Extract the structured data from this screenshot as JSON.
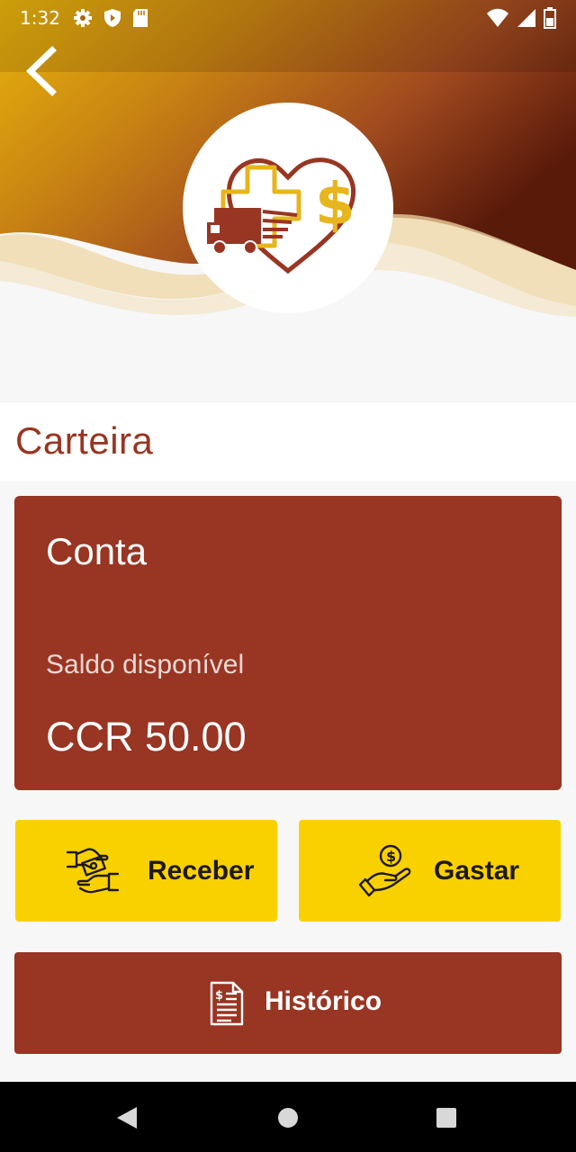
{
  "status_bar": {
    "time": "1:32",
    "left_icons": [
      "gear-icon",
      "shield-icon",
      "sd-card-icon"
    ],
    "right_icons": [
      "wifi-icon",
      "signal-icon",
      "battery-icon"
    ]
  },
  "header": {
    "back_icon": "chevron-left-icon",
    "logo": "truck-cross-heart-dollar-logo",
    "gradient_colors": [
      "#e8b10b",
      "#b5701e",
      "#8d3520",
      "#5e1d0c"
    ]
  },
  "page": {
    "title": "Carteira"
  },
  "account_card": {
    "name": "Conta",
    "balance_label": "Saldo disponível",
    "balance_value": "CCR 50.00",
    "color": "#983523"
  },
  "actions": {
    "receive_label": "Receber",
    "receive_icon": "hands-exchange-money-icon",
    "spend_label": "Gastar",
    "spend_icon": "hand-coin-icon",
    "history_label": "Histórico",
    "history_icon": "document-dollar-icon",
    "yellow": "#fad100"
  },
  "nav_bar": {
    "icons": [
      "back-triangle-icon",
      "home-circle-icon",
      "recents-square-icon"
    ]
  }
}
